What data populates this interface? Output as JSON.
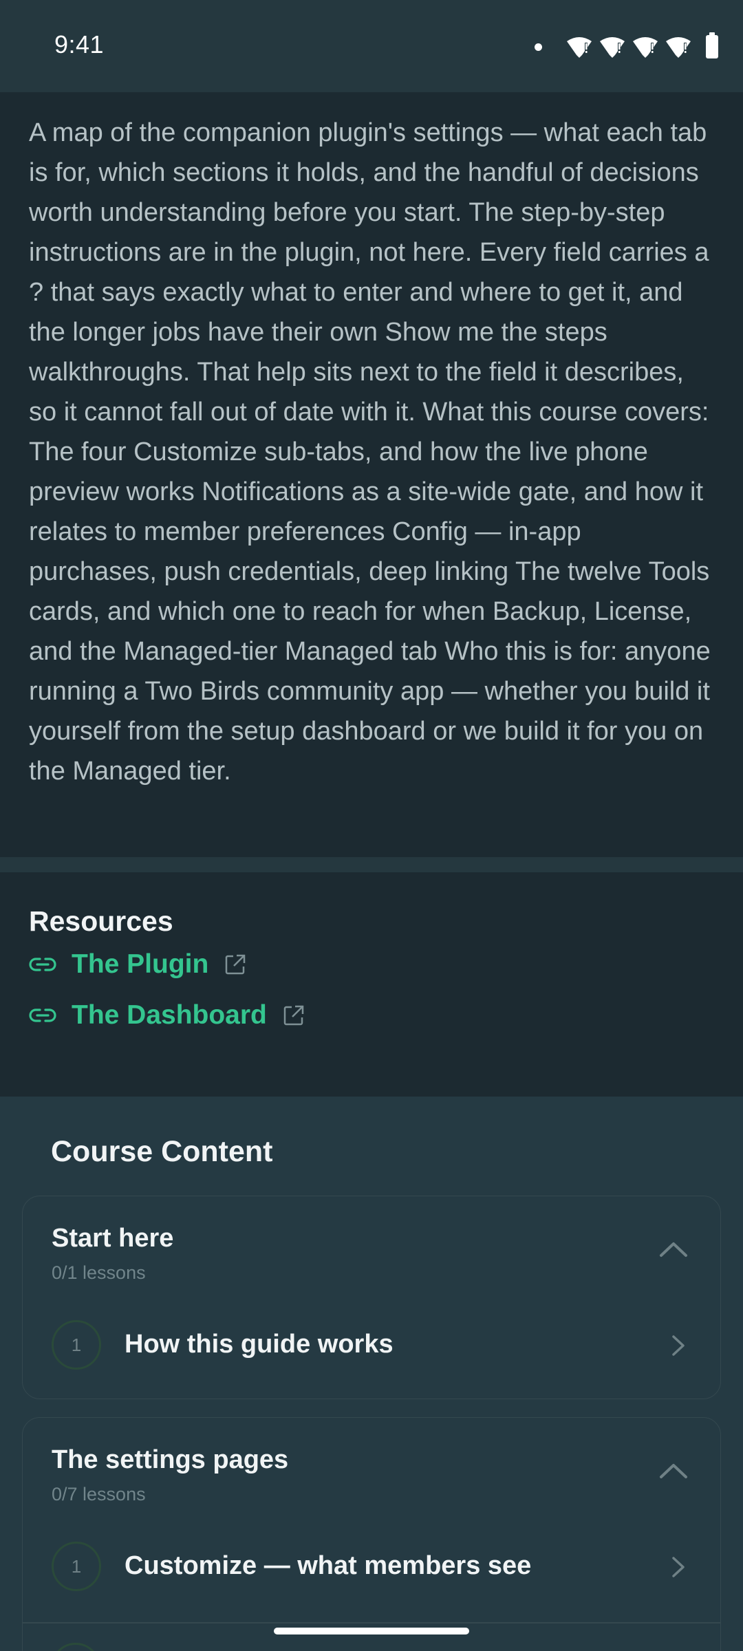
{
  "status_bar": {
    "time": "9:41"
  },
  "description": {
    "text": "A map of the companion plugin's settings — what each tab is for, which sections it holds, and the handful of decisions worth understanding before you start. The step-by-step instructions are in the plugin, not here. Every field carries a ? that says exactly what to enter and where to get it, and the longer jobs have their own Show me the steps walkthroughs. That help sits next to the field it describes, so it cannot fall out of date with it. What this course covers: The four Customize sub-tabs, and how the live phone preview works Notifications as a site-wide gate, and how it relates to member preferences Config — in-app purchases, push credentials, deep linking The twelve Tools cards, and which one to reach for when Backup, License, and the Managed-tier Managed tab Who this is for: anyone running a Two Birds community app — whether you build it yourself from the setup dashboard or we build it for you on the Managed tier."
  },
  "resources": {
    "title": "Resources",
    "links": [
      {
        "label": "The Plugin",
        "icon": "link-icon",
        "trailing_icon": "external-link-icon"
      },
      {
        "label": "The Dashboard",
        "icon": "link-icon",
        "trailing_icon": "external-link-icon"
      }
    ]
  },
  "course_content": {
    "title": "Course Content",
    "sections": [
      {
        "title": "Start here",
        "progress": "0/1 lessons",
        "expanded": true,
        "lessons": [
          {
            "number": "1",
            "title": "How this guide works"
          }
        ]
      },
      {
        "title": "The settings pages",
        "progress": "0/7 lessons",
        "expanded": true,
        "lessons": [
          {
            "number": "1",
            "title": "Customize — what members see"
          }
        ]
      }
    ]
  },
  "colors": {
    "accent": "#34c58f",
    "background": "#1c2a31",
    "card_background": "#253a43",
    "text_primary": "#f1f4f5",
    "text_secondary": "#b6c2c6"
  }
}
